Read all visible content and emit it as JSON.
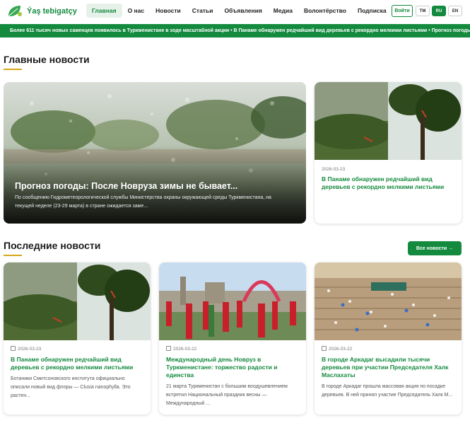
{
  "header": {
    "logo_text": "Ýaş tebigatçy",
    "logo_sub": "ýaş tebigatçy",
    "nav": [
      "Главная",
      "О нас",
      "Новости",
      "Статьи",
      "Объявления",
      "Медиа",
      "Волонтёрство",
      "Подписка"
    ],
    "login_label": "Войти",
    "languages": [
      "TM",
      "RU",
      "EN"
    ],
    "active_language": "RU"
  },
  "ticker": {
    "text": "Более 611 тысяч новых саженцев появилось в Туркменистане в ходе масштабной акции • В Панаме обнаружен редчайший вид деревьев с рекордно мелкими листьями • Прогноз погоды"
  },
  "main_news": {
    "heading": "Главные новости",
    "hero": {
      "title": "Прогноз погоды: После Новруза зимы не бывает...",
      "excerpt": "По сообщению Гидрометеорологической службы Министерства охраны окружающей среды Туркменистана, на текущей неделе (23-29 марта) в стране ожидается заме..."
    },
    "side": {
      "date": "2026-03-23",
      "title": "В Панаме обнаружен редчайший вид деревьев с рекордно мелкими листьями"
    }
  },
  "latest_news": {
    "heading": "Последние новости",
    "all_news_label": "Все новости →",
    "cards": [
      {
        "date": "2026-03-23",
        "title": "В Панаме обнаружен редчайший вид деревьев с рекордно мелкими листьями",
        "excerpt": "Ботаники Смитсоновского института официально описали новый вид флоры — Clusia nanophylla. Это растен..."
      },
      {
        "date": "2026-03-22",
        "title": "Международный день Новруз в Туркменистане: торжество радости и единства",
        "excerpt": "21 марта Туркменистан с большим воодушевлением встретил Национальный праздник весны — Международный ..."
      },
      {
        "date": "2026-03-22",
        "title": "В городе Аркадаг высадили тысячи деревьев при участии Председателя Халк Маслахаты",
        "excerpt": "В городе Аркадаг прошла массовая акция по посадке деревьев. В ней принял участие Председатель Халк М..."
      }
    ]
  },
  "colors": {
    "brand_green": "#138a3e",
    "accent_gold": "#d6a717"
  }
}
